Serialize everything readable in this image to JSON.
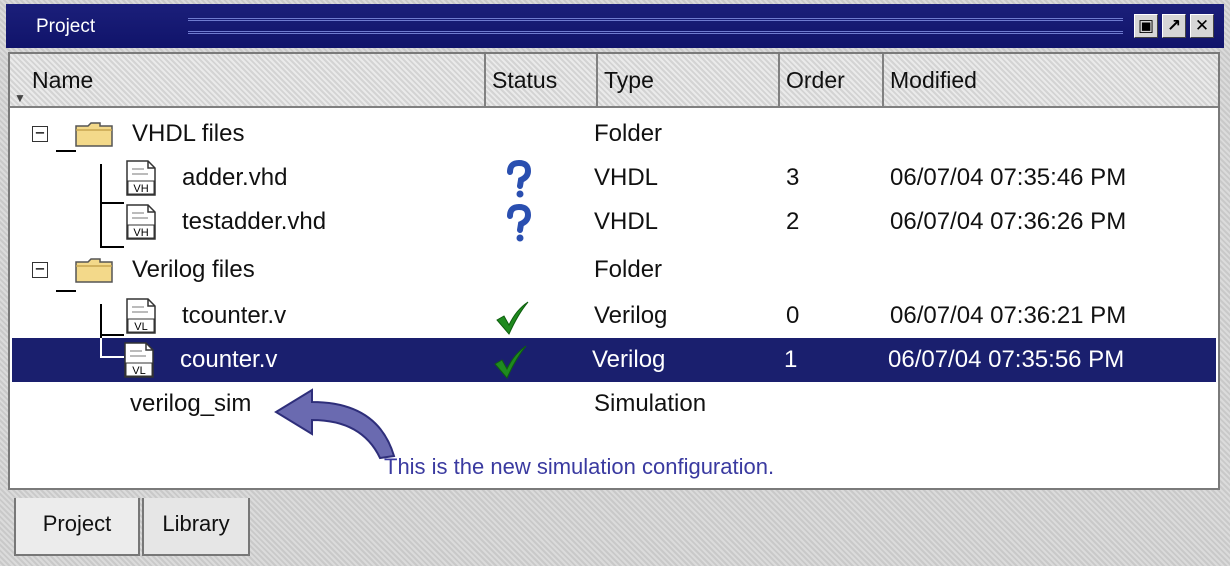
{
  "window": {
    "title": "Project",
    "buttons": [
      "restore-icon",
      "undock-icon",
      "close-icon"
    ]
  },
  "columns": [
    "Name",
    "Status",
    "Type",
    "Order",
    "Modified"
  ],
  "rows": [
    {
      "name": "VHDL files",
      "status": "",
      "type": "Folder",
      "order": "",
      "modified": "",
      "kind": "folder"
    },
    {
      "name": "adder.vhd",
      "status": "question-icon",
      "type": "VHDL",
      "order": "3",
      "modified": "06/07/04 07:35:46 PM",
      "kind": "file",
      "badge": "VH"
    },
    {
      "name": "testadder.vhd",
      "status": "question-icon",
      "type": "VHDL",
      "order": "2",
      "modified": "06/07/04 07:36:26 PM",
      "kind": "file",
      "badge": "VH"
    },
    {
      "name": "Verilog files",
      "status": "",
      "type": "Folder",
      "order": "",
      "modified": "",
      "kind": "folder"
    },
    {
      "name": "tcounter.v",
      "status": "check-icon",
      "type": "Verilog",
      "order": "0",
      "modified": "06/07/04 07:36:21 PM",
      "kind": "file",
      "badge": "VL"
    },
    {
      "name": "counter.v",
      "status": "check-icon",
      "type": "Verilog",
      "order": "1",
      "modified": "06/07/04 07:35:56 PM",
      "kind": "file",
      "badge": "VL",
      "selected": true
    },
    {
      "name": "verilog_sim",
      "status": "",
      "type": "Simulation",
      "order": "",
      "modified": "",
      "kind": "sim"
    }
  ],
  "annotation": "This is the new simulation configuration.",
  "tabs": [
    "Project",
    "Library"
  ],
  "colors": {
    "titlebar": "#10136a",
    "selection": "#1a1f6e",
    "annotation": "#3a3aa0",
    "check": "#1f8a1f",
    "question": "#2a4fb0"
  }
}
